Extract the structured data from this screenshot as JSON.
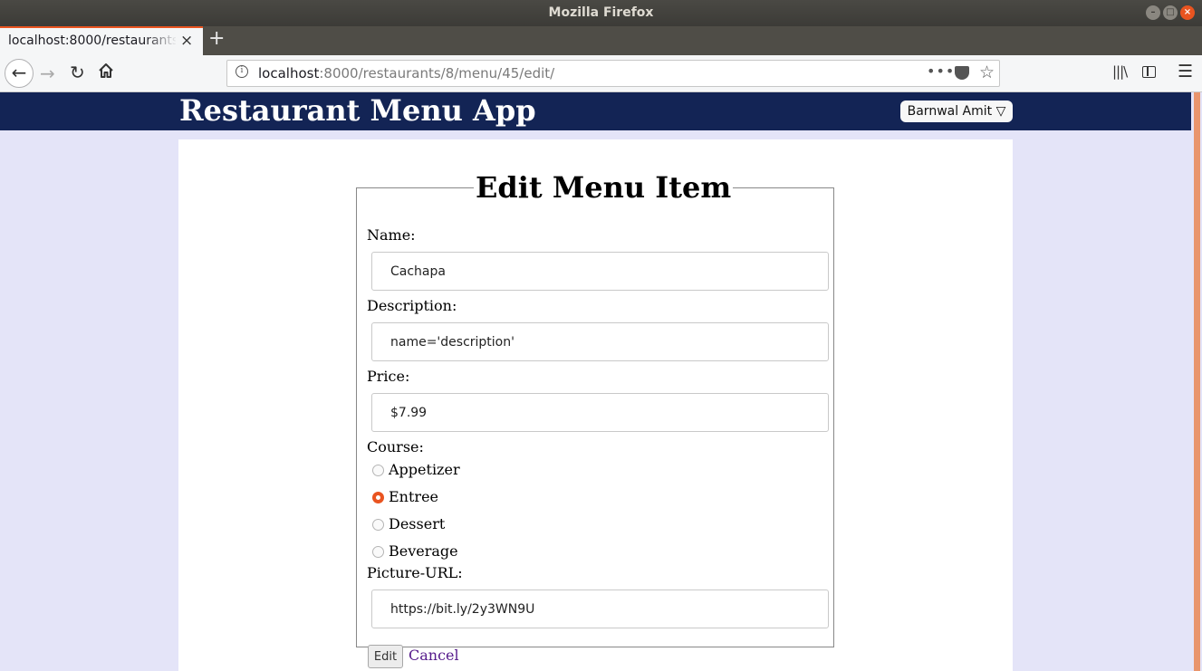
{
  "window": {
    "title": "Mozilla Firefox",
    "controls": {
      "minimize": "–",
      "maximize": "□",
      "close": "×"
    }
  },
  "tab": {
    "title": "localhost:8000/restaurants/8/menu/45/edit/",
    "close": "×",
    "new_tab": "+"
  },
  "nav": {
    "back_glyph": "←",
    "forward_glyph": "→",
    "reload_glyph": "↻",
    "url_host": "localhost",
    "url_rest": ":8000/restaurants/8/menu/45/edit/",
    "more_glyph": "•••",
    "star_glyph": "☆",
    "library_glyph": "|||\\",
    "menu_glyph": "☰"
  },
  "app": {
    "title": "Restaurant Menu App",
    "user_button": "Barnwal Amit ▽"
  },
  "form": {
    "legend": "Edit Menu Item",
    "name_label": "Name:",
    "name_value": "Cachapa",
    "description_label": "Description:",
    "description_value": "name='description'",
    "price_label": "Price:",
    "price_value": "$7.99",
    "course_label": "Course:",
    "courses": [
      {
        "label": "Appetizer",
        "checked": false
      },
      {
        "label": "Entree",
        "checked": true
      },
      {
        "label": "Dessert",
        "checked": false
      },
      {
        "label": "Beverage",
        "checked": false
      }
    ],
    "picture_label": "Picture-URL:",
    "picture_value": "https://bit.ly/2y3WN9U",
    "submit_label": "Edit",
    "cancel_label": "Cancel"
  },
  "colors": {
    "header_bg": "#132455",
    "page_bg": "#e4e4f8",
    "accent": "#e95420",
    "link": "#551a8b"
  }
}
